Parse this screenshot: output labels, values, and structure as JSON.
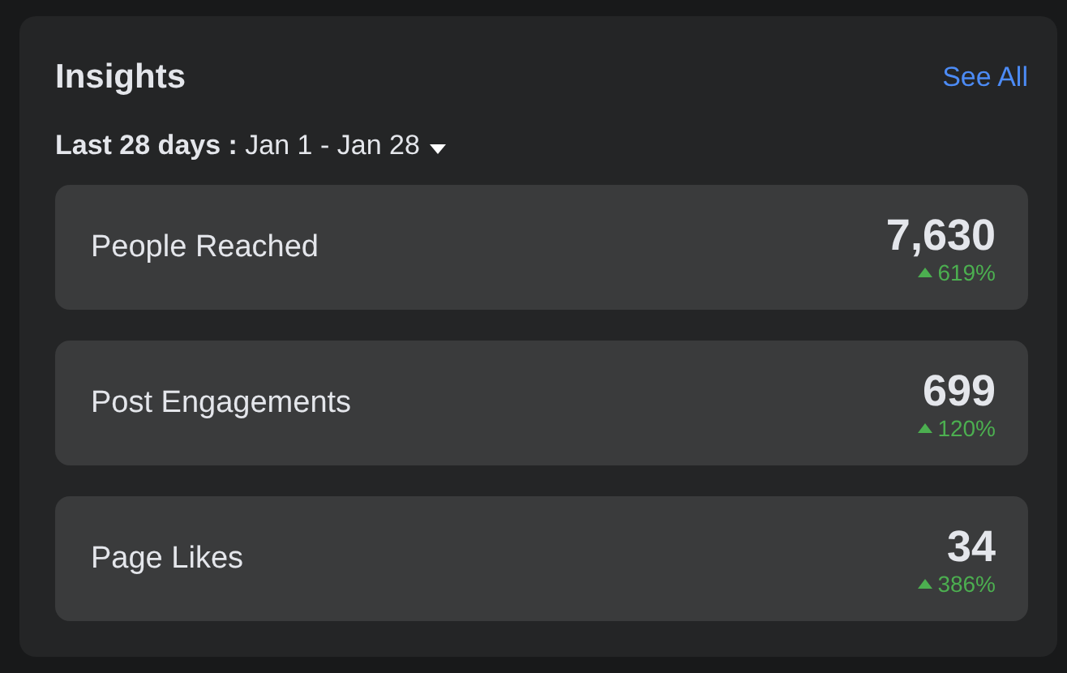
{
  "title": "Insights",
  "see_all": "See All",
  "date_range": "**Last 28 days :** Jan 1 - Jan 28",
  "metrics": [
    {
      "label": "People Reached",
      "value": "7,630",
      "change": "619%",
      "increase": true
    },
    {
      "label": "Post Engagements",
      "value": "699",
      "change": "120%",
      "increase": true
    },
    {
      "label": "Page Likes",
      "value": "34",
      "change": "386%",
      "increase": true
    }
  ]
}
